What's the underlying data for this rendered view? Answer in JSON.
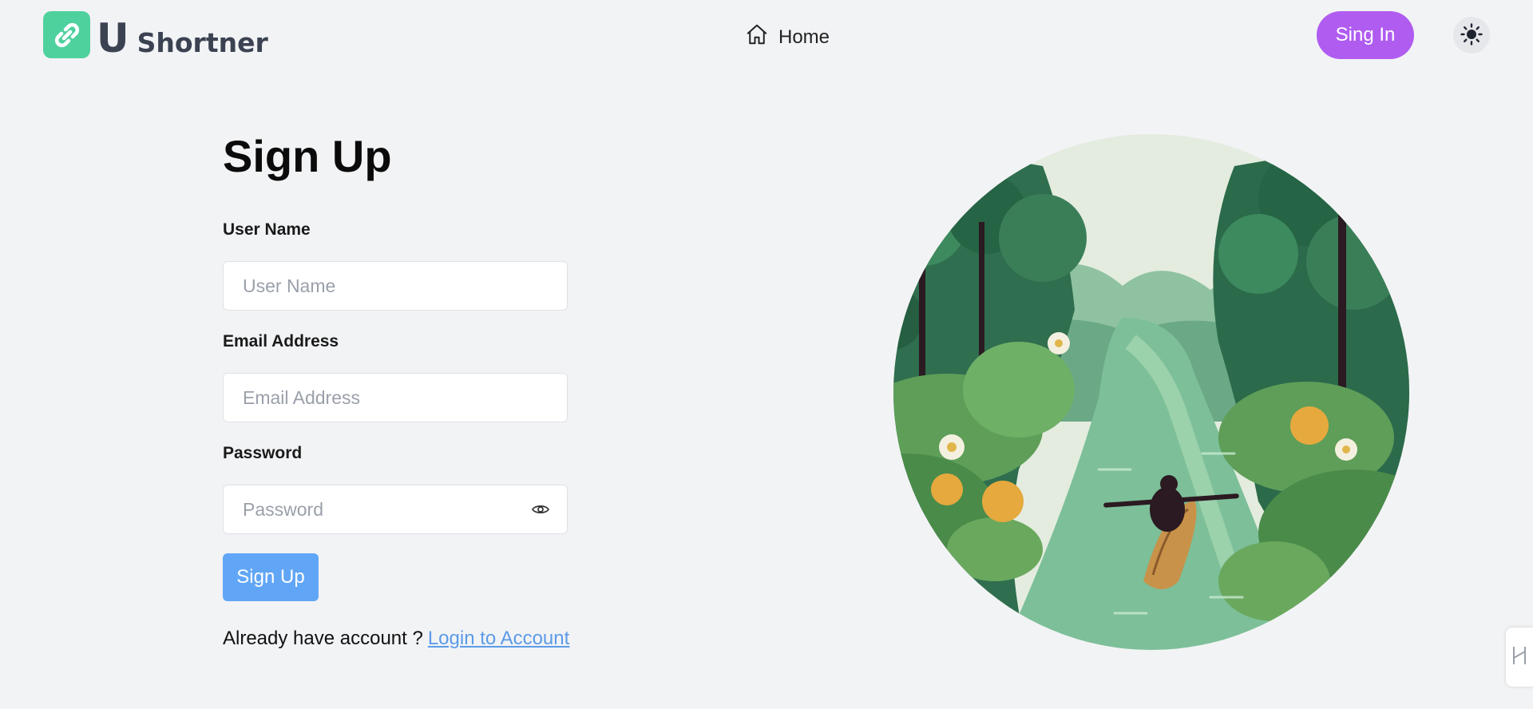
{
  "header": {
    "logo_letter": "U",
    "logo_word": "Shortner",
    "nav_home": "Home",
    "sign_in": "Sing In",
    "theme_icon": "sun-icon"
  },
  "form": {
    "title": "Sign Up",
    "username_label": "User Name",
    "username_placeholder": "User Name",
    "email_label": "Email Address",
    "email_placeholder": "Email Address",
    "password_label": "Password",
    "password_placeholder": "Password",
    "submit": "Sign Up",
    "footer_text": "Already have account ?",
    "footer_link": "Login to Account"
  },
  "illustration": {
    "icon": "river-kayak-illustration"
  },
  "colors": {
    "logo_badge": "#4fd19e",
    "sign_in_button": "#b05cf0",
    "submit_button": "#61a6f6",
    "link": "#5b9be8",
    "background": "#f2f3f5"
  }
}
